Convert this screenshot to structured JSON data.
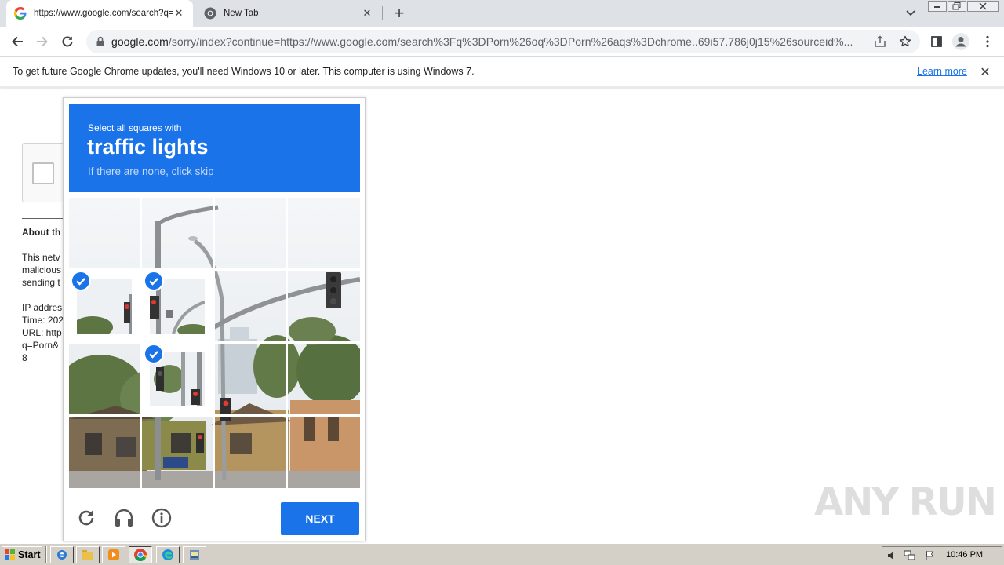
{
  "browser": {
    "tabs": [
      {
        "title": "https://www.google.com/search?q=",
        "icon": "google-icon",
        "active": true
      },
      {
        "title": "New Tab",
        "icon": "chrome-icon",
        "active": false
      }
    ],
    "new_tab_symbol": "+",
    "close_symbol": "✕",
    "omnibox": {
      "host": "google.com",
      "path": "/sorry/index?continue=https://www.google.com/search%3Fq%3DPorn%26oq%3DPorn%26aqs%3Dchrome..69i57.786j0j15%26sourceid%..."
    }
  },
  "infobar": {
    "message": "To get future Google Chrome updates, you'll need Windows 10 or later. This computer is using Windows 7.",
    "link": "Learn more"
  },
  "background_page": {
    "heading": "About th",
    "para": [
      "This netv",
      "malicious",
      "sending t"
    ],
    "details": [
      "IP addres",
      "Time: 202",
      "URL: http",
      "q=Porn&",
      "8"
    ]
  },
  "challenge": {
    "instruction": "Select all squares with",
    "target": "traffic lights",
    "hint": "If there are none, click skip",
    "next_label": "NEXT",
    "selected_tiles": [
      4,
      5,
      9
    ]
  },
  "watermark": "ANY RUN",
  "taskbar": {
    "start_label": "Start",
    "clock": "10:46 PM"
  },
  "colors": {
    "accent": "#1a73e8",
    "tabstrip": "#dee1e6",
    "taskbar": "#d4d0c8"
  }
}
